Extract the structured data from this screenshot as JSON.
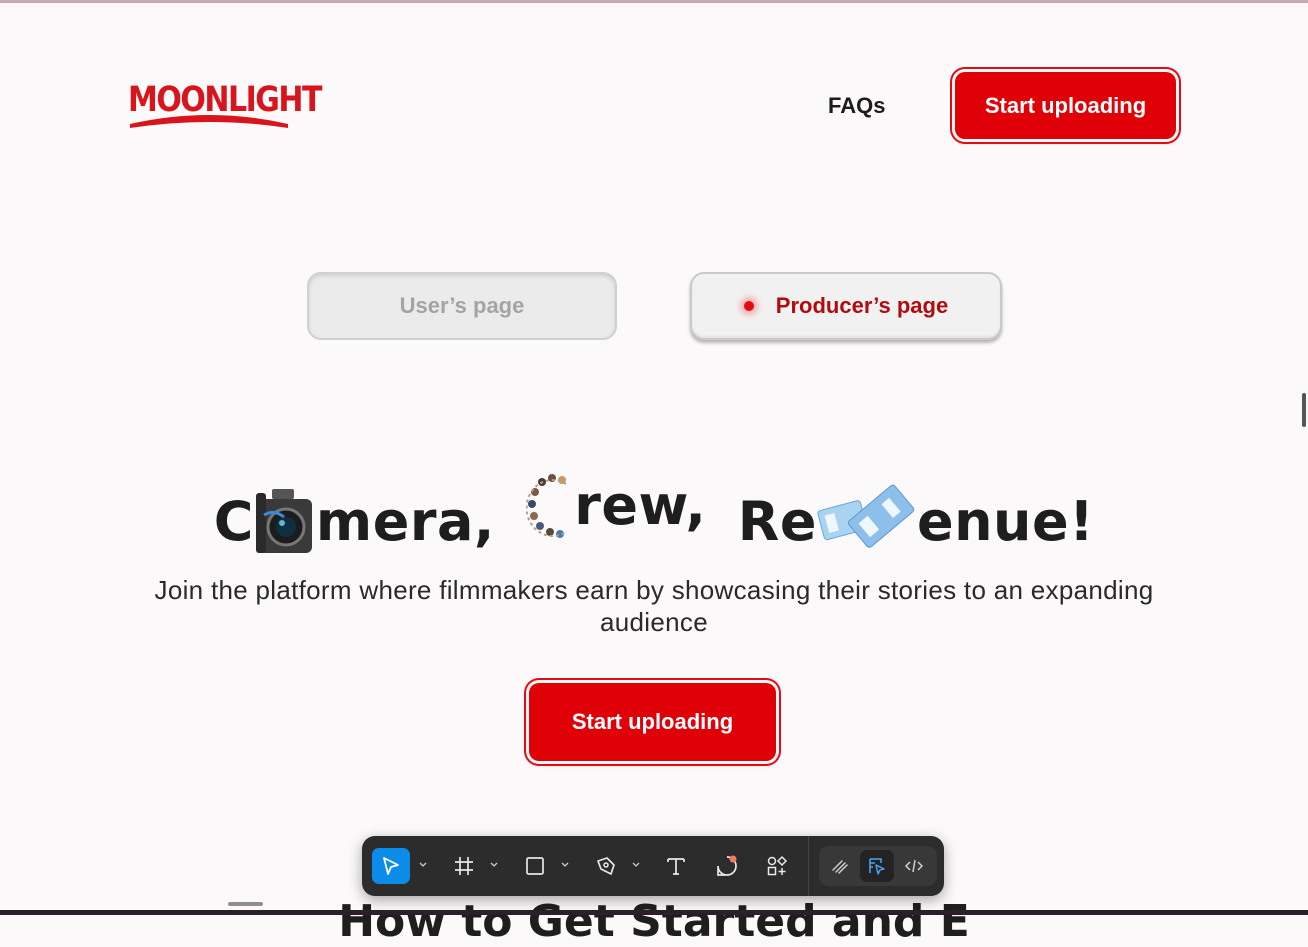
{
  "header": {
    "logo_text": "MOONLIGHT",
    "faqs_label": "FAQs",
    "upload_label": "Start uploading"
  },
  "toggle": {
    "user_label": "User’s page",
    "producer_label": "Producer’s page",
    "selected": "Producer’s page"
  },
  "hero": {
    "word1": "Camera,",
    "word2": "Crew,",
    "word3": "Revenue!",
    "word1_parts": [
      "C",
      "mera,"
    ],
    "word2_parts": [
      "",
      "rew,"
    ],
    "word3_parts": [
      "Re",
      "enue!"
    ],
    "subtitle": "Join the platform where filmmakers earn by showcasing their stories to an expanding audience",
    "cta_label": "Start uploading"
  },
  "next_section": {
    "title": "How to Get Started and E"
  },
  "toolbar": {
    "tools": [
      "move-icon",
      "frame-icon",
      "rectangle-icon",
      "pen-icon",
      "text-icon",
      "comment-icon",
      "actions-icon"
    ],
    "modes": [
      "draw-icon",
      "design-icon",
      "dev-mode-icon"
    ],
    "active_tool": "move-icon",
    "selected_mode": "design-icon"
  },
  "colors": {
    "brand_red": "#e00008",
    "active_tool_blue": "#0c8ce9",
    "toolbar_bg": "#2c2c2c",
    "page_bg": "#fcf9fa"
  }
}
